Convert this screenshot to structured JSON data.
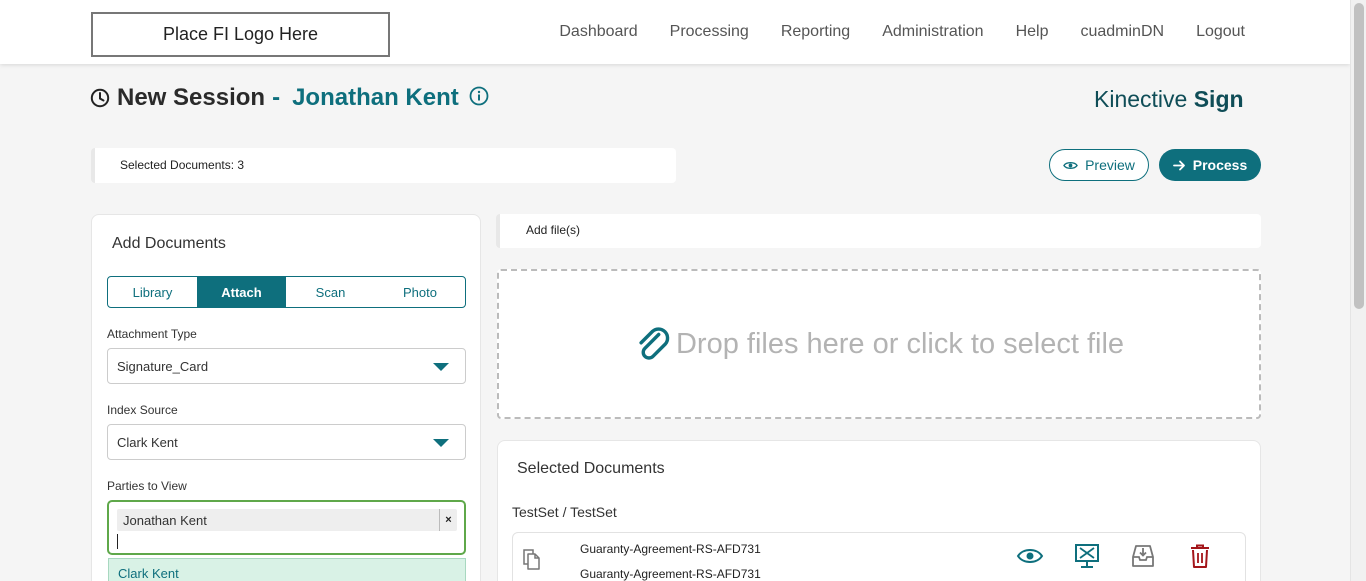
{
  "header": {
    "logo_text": "Place FI Logo Here",
    "nav": [
      "Dashboard",
      "Processing",
      "Reporting",
      "Administration",
      "Help",
      "cuadminDN",
      "Logout"
    ]
  },
  "title": {
    "prefix": "New Session",
    "separator": "-",
    "name": "Jonathan Kent"
  },
  "brand": {
    "light": "Kinective",
    "bold": "Sign"
  },
  "selected_strip": {
    "text": "Selected Documents: 3"
  },
  "actions": {
    "preview_label": "Preview",
    "process_label": "Process"
  },
  "add_documents": {
    "title": "Add Documents",
    "tabs": [
      "Library",
      "Attach",
      "Scan",
      "Photo"
    ],
    "active_tab": "Attach",
    "attachment_type_label": "Attachment Type",
    "attachment_type_value": "Signature_Card",
    "index_source_label": "Index Source",
    "index_source_value": "Clark Kent",
    "parties_label": "Parties to View",
    "parties_selected": [
      "Jonathan Kent"
    ],
    "chip_remove": "×",
    "dropdown_option": "Clark Kent"
  },
  "add_files": {
    "label": "Add file(s)"
  },
  "dropzone": {
    "text": "Drop files here or click to select file"
  },
  "selected_documents": {
    "title": "Selected Documents",
    "set_label": "TestSet / TestSet",
    "documents": [
      {
        "line1": "Guaranty-Agreement-RS-AFD731",
        "line2": "Guaranty-Agreement-RS-AFD731"
      }
    ]
  },
  "colors": {
    "primary": "#0e6f7d",
    "delete": "#a3151a",
    "focus_border": "#5fa84a"
  },
  "icons": [
    "clock-icon",
    "info-icon",
    "eye-icon",
    "arrow-right-icon",
    "paperclip-icon",
    "documents-icon",
    "view-icon",
    "signature-screen-icon",
    "download-tray-icon",
    "trash-icon"
  ]
}
